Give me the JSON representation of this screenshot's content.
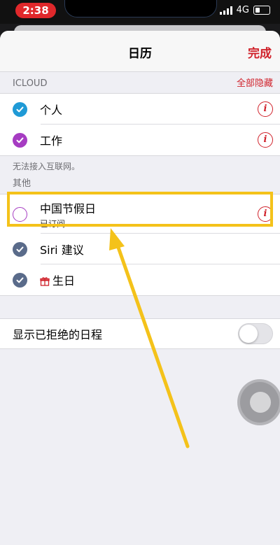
{
  "status_bar": {
    "time": "2:38",
    "network": "4G"
  },
  "nav": {
    "title": "日历",
    "done": "完成"
  },
  "icloud": {
    "header": "ICLOUD",
    "hide_all": "全部隐藏",
    "items": [
      {
        "label": "个人",
        "color": "#1f9ad6",
        "checked": true
      },
      {
        "label": "工作",
        "color": "#a63cc2",
        "checked": true
      }
    ]
  },
  "offline_note": "无法接入互联网。",
  "other": {
    "header": "其他",
    "items": [
      {
        "label": "中国节假日",
        "sublabel": "已订阅",
        "color": "#a63cc2",
        "checked": false
      },
      {
        "label": "Siri 建议",
        "color": "#5a6b8a",
        "checked": true
      },
      {
        "label": "生日",
        "color": "#5a6b8a",
        "checked": true,
        "icon": "gift-icon"
      }
    ]
  },
  "declined": {
    "label": "显示已拒绝的日程",
    "enabled": false
  },
  "colors": {
    "accent": "#d0222b",
    "highlight": "#f4c21a"
  },
  "info_glyph": "i"
}
